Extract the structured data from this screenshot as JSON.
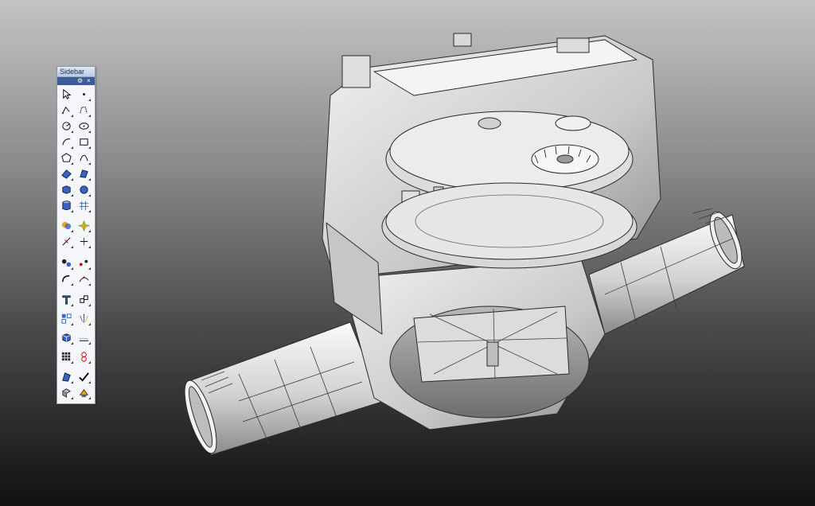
{
  "sidebar": {
    "title": "Sidebar",
    "settings_icon": "gear-icon",
    "close_glyph": "×",
    "tools": [
      {
        "name": "select-arrow-icon",
        "submenu": false
      },
      {
        "name": "point-icon",
        "submenu": true
      },
      {
        "name": "polyline-icon",
        "submenu": true
      },
      {
        "name": "curve-control-points-icon",
        "submenu": true
      },
      {
        "name": "circle-icon",
        "submenu": true
      },
      {
        "name": "ellipse-icon",
        "submenu": true
      },
      {
        "name": "arc-icon",
        "submenu": true
      },
      {
        "name": "rectangle-icon",
        "submenu": true
      },
      {
        "name": "polygon-icon",
        "submenu": true
      },
      {
        "name": "curve-tools-icon",
        "submenu": true
      },
      {
        "name": "surface-icon",
        "submenu": true
      },
      {
        "name": "surface-edit-icon",
        "submenu": true
      },
      {
        "name": "box-solid-icon",
        "submenu": true
      },
      {
        "name": "sphere-solid-icon",
        "submenu": true
      },
      {
        "name": "cylinder-solid-icon",
        "submenu": true
      },
      {
        "name": "mesh-icon",
        "submenu": true
      },
      {
        "name": "boolean-icon",
        "submenu": true
      },
      {
        "name": "explode-icon",
        "submenu": true
      },
      {
        "name": "trim-icon",
        "submenu": true
      },
      {
        "name": "split-icon",
        "submenu": true
      },
      {
        "name": "group-icon",
        "submenu": true
      },
      {
        "name": "point-edit-icon",
        "submenu": true
      },
      {
        "name": "fillet-icon",
        "submenu": true
      },
      {
        "name": "join-icon",
        "submenu": true
      },
      {
        "name": "text-icon",
        "submenu": true
      },
      {
        "name": "transform-icon",
        "submenu": true
      },
      {
        "name": "array-icon",
        "submenu": true
      },
      {
        "name": "mirror-icon",
        "submenu": true
      },
      {
        "name": "block-icon",
        "submenu": true
      },
      {
        "name": "dimension-icon",
        "submenu": true
      },
      {
        "name": "grid-icon",
        "submenu": true
      },
      {
        "name": "analyze-icon",
        "submenu": true
      },
      {
        "name": "render-icon",
        "submenu": true
      },
      {
        "name": "check-icon",
        "submenu": true
      },
      {
        "name": "hide-icon",
        "submenu": true
      },
      {
        "name": "lock-icon",
        "submenu": true
      }
    ]
  },
  "colors": {
    "sidebar_bg": "#f4f6fa",
    "titlebar": "#b9cbe6",
    "toolbar_strip": "#3d5c95",
    "icon_blue": "#3b63c4",
    "icon_orange": "#f0a21a",
    "model_light": "#e8e8e8",
    "model_edge": "#2a2a2a"
  }
}
